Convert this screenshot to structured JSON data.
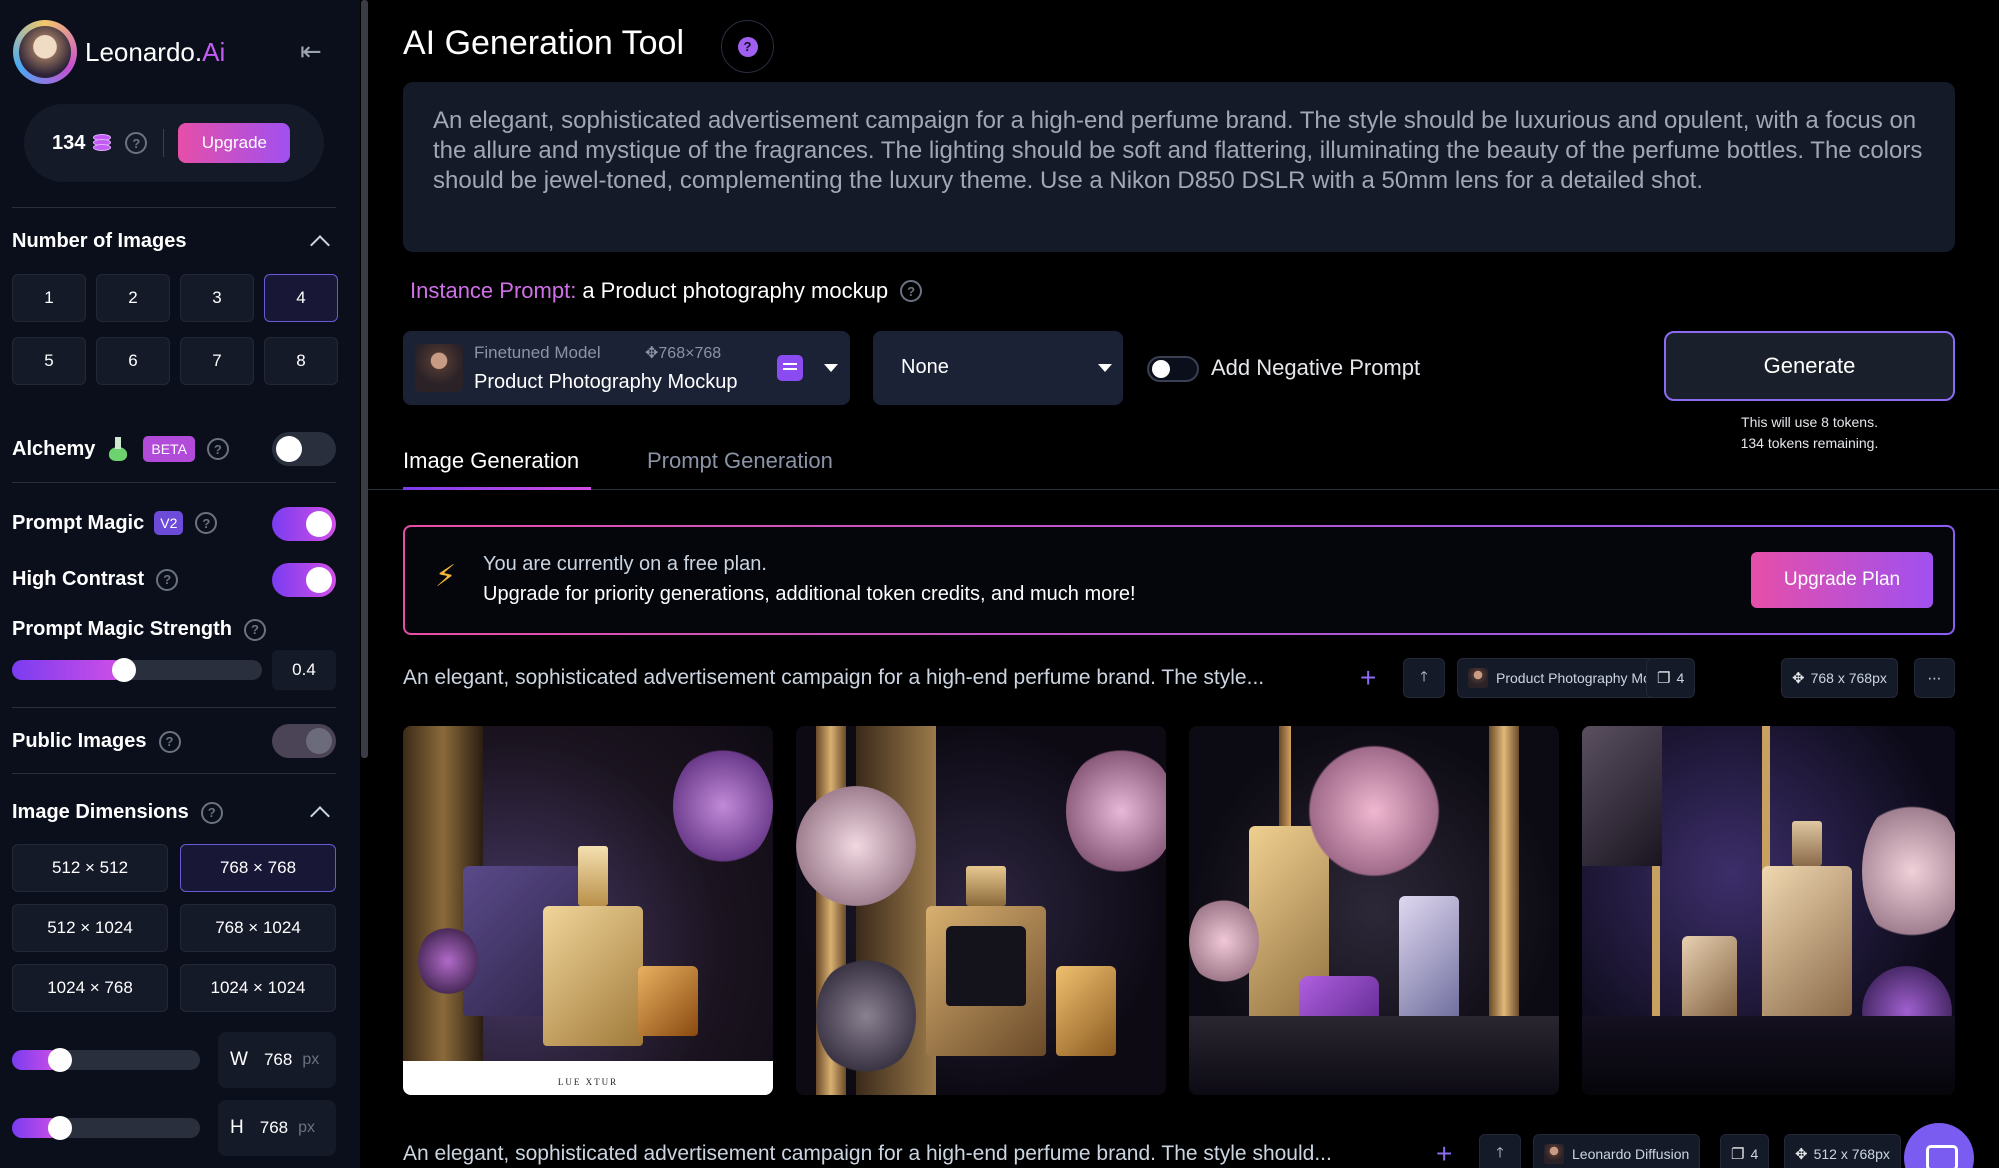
{
  "brand": {
    "name_main": "Leonardo.",
    "name_ai": "Ai"
  },
  "tokens": {
    "count": "134",
    "upgrade_label": "Upgrade"
  },
  "sidebar": {
    "num_images": {
      "title": "Number of Images",
      "options": [
        "1",
        "2",
        "3",
        "4",
        "5",
        "6",
        "7",
        "8"
      ],
      "selected": "4"
    },
    "alchemy": {
      "label": "Alchemy",
      "badge": "BETA",
      "enabled": false
    },
    "prompt_magic": {
      "label": "Prompt Magic",
      "badge": "V2",
      "enabled": true
    },
    "high_contrast": {
      "label": "High Contrast",
      "enabled": true
    },
    "pm_strength": {
      "label": "Prompt Magic Strength",
      "value": "0.4",
      "fraction": 0.4
    },
    "public_images": {
      "label": "Public Images",
      "enabled": true
    },
    "dimensions": {
      "title": "Image Dimensions",
      "options": [
        "512 × 512",
        "768 × 768",
        "512 × 1024",
        "768 × 1024",
        "1024 × 768",
        "1024 × 1024"
      ],
      "selected": "768 × 768",
      "width": {
        "label": "W",
        "value": "768",
        "unit": "px"
      },
      "height": {
        "label": "H",
        "value": "768",
        "unit": "px"
      }
    }
  },
  "main": {
    "title": "AI Generation Tool",
    "prompt": "An elegant, sophisticated advertisement campaign for a high-end perfume brand. The style should be luxurious and opulent, with a focus on the allure and mystique of the fragrances. The lighting should be soft and flattering, illuminating the beauty of the perfume bottles. The colors should be jewel-toned, complementing the luxury theme. Use a Nikon D850 DSLR with a 50mm lens for a detailed shot.",
    "instance_prompt": {
      "key": "Instance Prompt:",
      "value": "a Product photography mockup"
    },
    "model": {
      "type": "Finetuned Model",
      "resolution": "768×768",
      "name": "Product Photography Mockup"
    },
    "style": "None",
    "negative_prompt_label": "Add Negative Prompt",
    "generate": {
      "label": "Generate",
      "note_line1": "This will use 8 tokens.",
      "note_line2": "134 tokens remaining."
    },
    "tabs": [
      {
        "label": "Image Generation"
      },
      {
        "label": "Prompt Generation"
      }
    ],
    "banner": {
      "line1": "You are currently on a free plan.",
      "line2": "Upgrade for priority generations, additional token credits, and much more!",
      "button": "Upgrade Plan"
    },
    "generations": [
      {
        "prompt": "An elegant, sophisticated advertisement campaign for a high-end perfume brand. The style...",
        "model": "Product Photography Mockup",
        "count": "4",
        "size": "768 x 768px"
      },
      {
        "prompt": "An elegant, sophisticated advertisement campaign for a high-end perfume brand. The style should...",
        "model": "Leonardo Diffusion",
        "count": "4",
        "size": "512 x 768px"
      }
    ],
    "image_label": "LUE XTUR"
  },
  "colors": {
    "accent_purple": "#8b6bf0",
    "accent_pink": "#e64fa8",
    "background": "#000000",
    "panel": "#151a29"
  }
}
